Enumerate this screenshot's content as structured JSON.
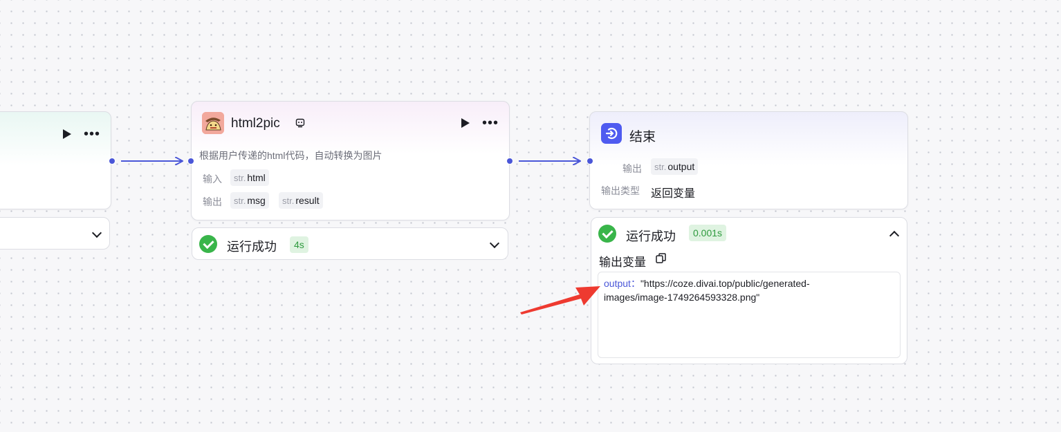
{
  "left_node": {},
  "html2pic_node": {
    "title": "html2pic",
    "description": "根据用户传递的html代码，自动转换为图片",
    "input_label": "输入",
    "output_label": "输出",
    "inputs": [
      {
        "type": "str.",
        "name": "html"
      }
    ],
    "outputs": [
      {
        "type": "str.",
        "name": "msg"
      },
      {
        "type": "str.",
        "name": "result"
      }
    ],
    "status": "运行成功",
    "duration": "4s"
  },
  "end_node": {
    "title": "结束",
    "output_label": "输出",
    "output_var": {
      "type": "str.",
      "name": "output"
    },
    "output_type_label": "输出类型",
    "output_type_value": "返回变量",
    "status": "运行成功",
    "duration": "0.001s",
    "vars_title": "输出变量",
    "result_key": "output",
    "result_sep": "：",
    "result_value_line1": "\"https://coze.divai.top/public/generated-",
    "result_value_line2": "images/image-1749264593328.png\""
  },
  "colors": {
    "accent": "#4a56d8",
    "success": "#39b54a",
    "arrow_annotation": "#ee3a30"
  }
}
